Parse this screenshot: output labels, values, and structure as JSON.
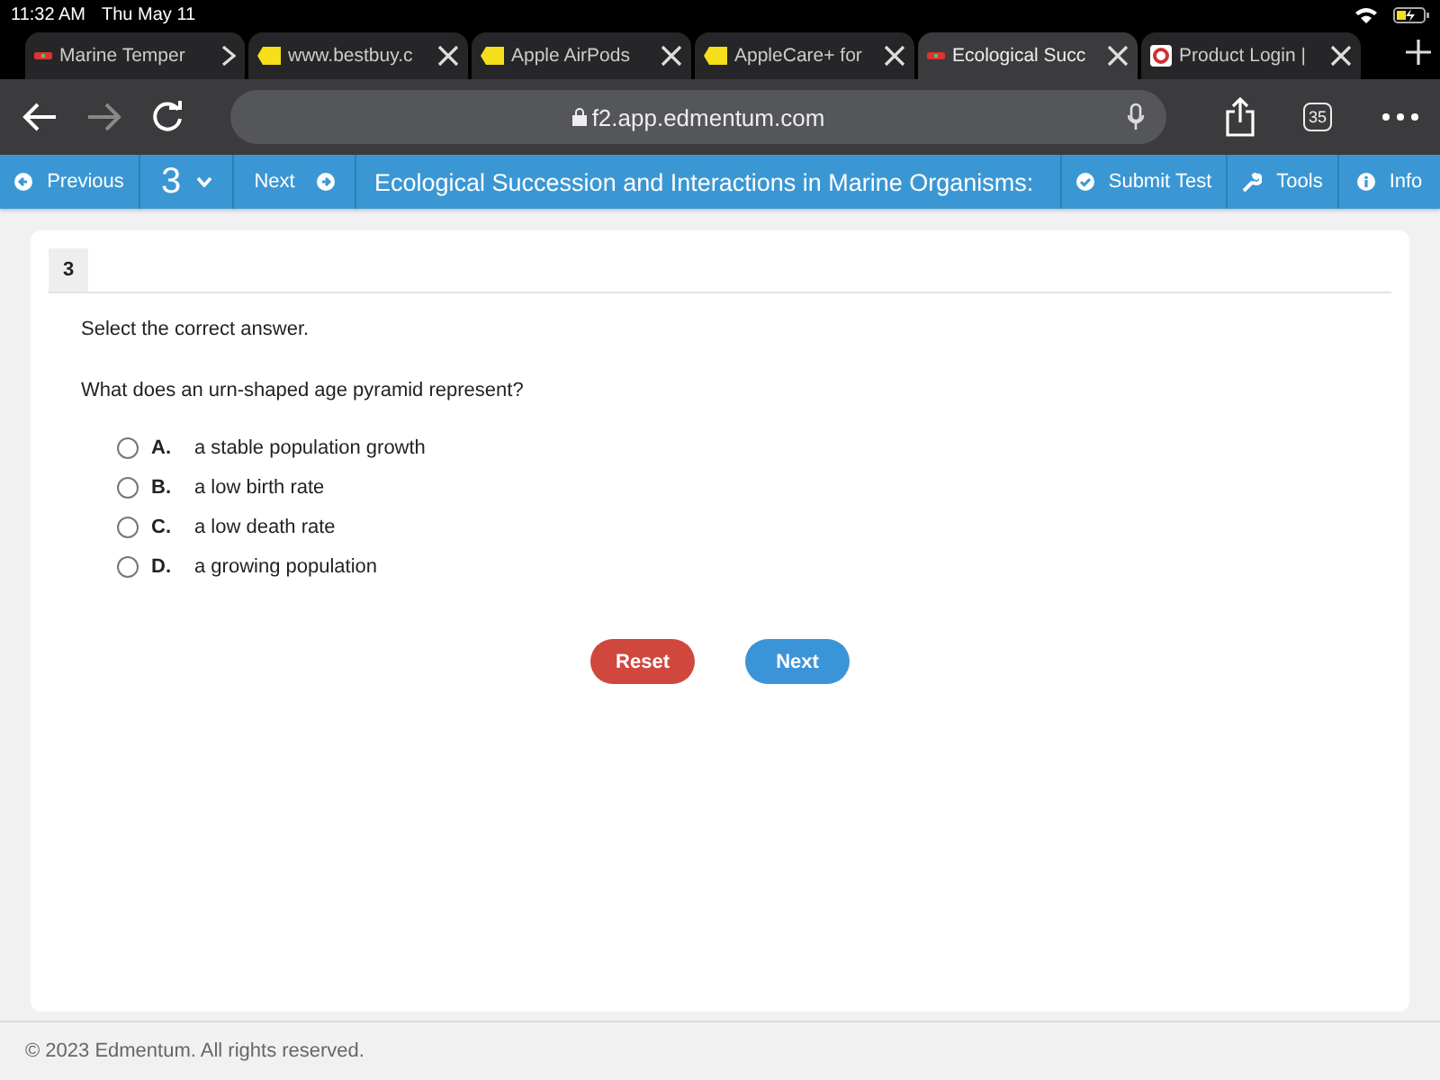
{
  "status_bar": {
    "time": "11:32 AM",
    "date": "Thu May 11"
  },
  "browser_tabs": [
    {
      "title": "Marine Temper",
      "selected": false
    },
    {
      "title": "www.bestbuy.c",
      "selected": false
    },
    {
      "title": "Apple AirPods",
      "selected": false
    },
    {
      "title": "AppleCare+ for",
      "selected": false
    },
    {
      "title": "Ecological Succ",
      "selected": true
    },
    {
      "title": "Product Login |",
      "selected": false
    }
  ],
  "address_bar": {
    "url": "f2.app.edmentum.com",
    "tab_count": "35"
  },
  "toolbar": {
    "previous": "Previous",
    "question_number": "3",
    "next": "Next",
    "title": "Ecological Succession and Interactions in Marine Organisms:",
    "submit": "Submit Test",
    "tools": "Tools",
    "info": "Info"
  },
  "question": {
    "number": "3",
    "instruction": "Select the correct answer.",
    "prompt": "What does an urn-shaped age pyramid represent?",
    "options": [
      {
        "letter": "A.",
        "text": "a stable population growth",
        "selected": false
      },
      {
        "letter": "B.",
        "text": "a low birth rate",
        "selected": false
      },
      {
        "letter": "C.",
        "text": "a low death rate",
        "selected": false
      },
      {
        "letter": "D.",
        "text": "a growing population",
        "selected": false
      }
    ],
    "buttons": {
      "reset": "Reset",
      "next": "Next"
    }
  },
  "footer": "© 2023 Edmentum. All rights reserved."
}
